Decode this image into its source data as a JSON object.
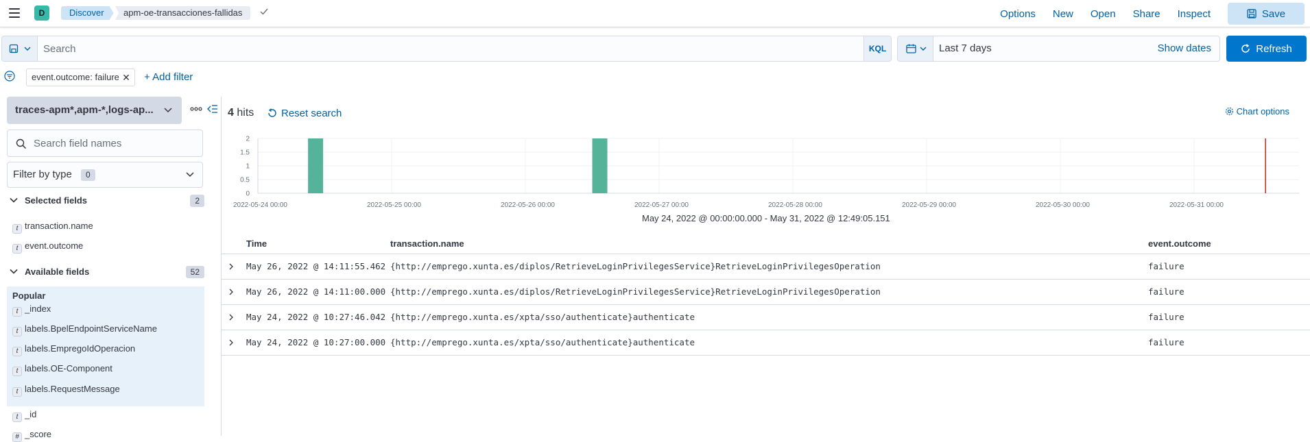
{
  "header": {
    "space_initial": "D",
    "breadcrumbs": [
      "Discover",
      "apm-oe-transacciones-fallidas"
    ],
    "links": [
      "Options",
      "New",
      "Open",
      "Share",
      "Inspect"
    ],
    "save_label": "Save"
  },
  "query": {
    "placeholder": "Search",
    "language": "KQL",
    "date_range": "Last 7 days",
    "show_dates": "Show dates",
    "refresh_label": "Refresh"
  },
  "filters": {
    "pills": [
      "event.outcome: failure"
    ],
    "add_filter": "+ Add filter"
  },
  "sidebar": {
    "index_pattern": "traces-apm*,apm-*,logs-ap...",
    "search_placeholder": "Search field names",
    "filter_by_type": "Filter by type",
    "filter_count": "0",
    "selected_title": "Selected fields",
    "selected_count": "2",
    "selected_fields": [
      {
        "type": "t",
        "name": "transaction.name"
      },
      {
        "type": "t",
        "name": "event.outcome"
      }
    ],
    "available_title": "Available fields",
    "available_count": "52",
    "popular_title": "Popular",
    "popular_fields": [
      {
        "type": "t",
        "name": "_index"
      },
      {
        "type": "t",
        "name": "labels.BpelEndpointServiceName"
      },
      {
        "type": "t",
        "name": "labels.EmpregoIdOperacion"
      },
      {
        "type": "t",
        "name": "labels.OE-Component"
      },
      {
        "type": "t",
        "name": "labels.RequestMessage"
      }
    ],
    "other_fields": [
      {
        "type": "t",
        "name": "_id"
      },
      {
        "type": "#",
        "name": "_score"
      }
    ]
  },
  "main": {
    "hits_count": "4",
    "hits_label": "hits",
    "reset_search": "Reset search",
    "chart_options": "Chart options",
    "range_label": "May 24, 2022 @ 00:00:00.000 - May 31, 2022 @ 12:49:05.151",
    "columns": [
      "Time",
      "transaction.name",
      "event.outcome"
    ],
    "rows": [
      {
        "time": "May 26, 2022 @ 14:11:55.462",
        "name": "{http://emprego.xunta.es/diplos/RetrieveLoginPrivilegesService}RetrieveLoginPrivilegesOperation",
        "outcome": "failure"
      },
      {
        "time": "May 26, 2022 @ 14:11:00.000",
        "name": "{http://emprego.xunta.es/diplos/RetrieveLoginPrivilegesService}RetrieveLoginPrivilegesOperation",
        "outcome": "failure"
      },
      {
        "time": "May 24, 2022 @ 10:27:46.042",
        "name": "{http://emprego.xunta.es/xpta/sso/authenticate}authenticate",
        "outcome": "failure"
      },
      {
        "time": "May 24, 2022 @ 10:27:00.000",
        "name": "{http://emprego.xunta.es/xpta/sso/authenticate}authenticate",
        "outcome": "failure"
      }
    ]
  },
  "chart_data": {
    "type": "bar",
    "x_ticks": [
      "2022-05-24 00:00",
      "2022-05-25 00:00",
      "2022-05-26 00:00",
      "2022-05-27 00:00",
      "2022-05-28 00:00",
      "2022-05-29 00:00",
      "2022-05-30 00:00",
      "2022-05-31 00:00"
    ],
    "y_ticks": [
      "0",
      "0.5",
      "1",
      "1.5",
      "2"
    ],
    "ylim": [
      0,
      2
    ],
    "bars": [
      {
        "x": "2022-05-24 09:00",
        "value": 2
      },
      {
        "x": "2022-05-26 12:00",
        "value": 2
      }
    ],
    "now_marker": "2022-05-31 12:49",
    "bar_color": "#54b399",
    "marker_color": "#bd271e"
  }
}
